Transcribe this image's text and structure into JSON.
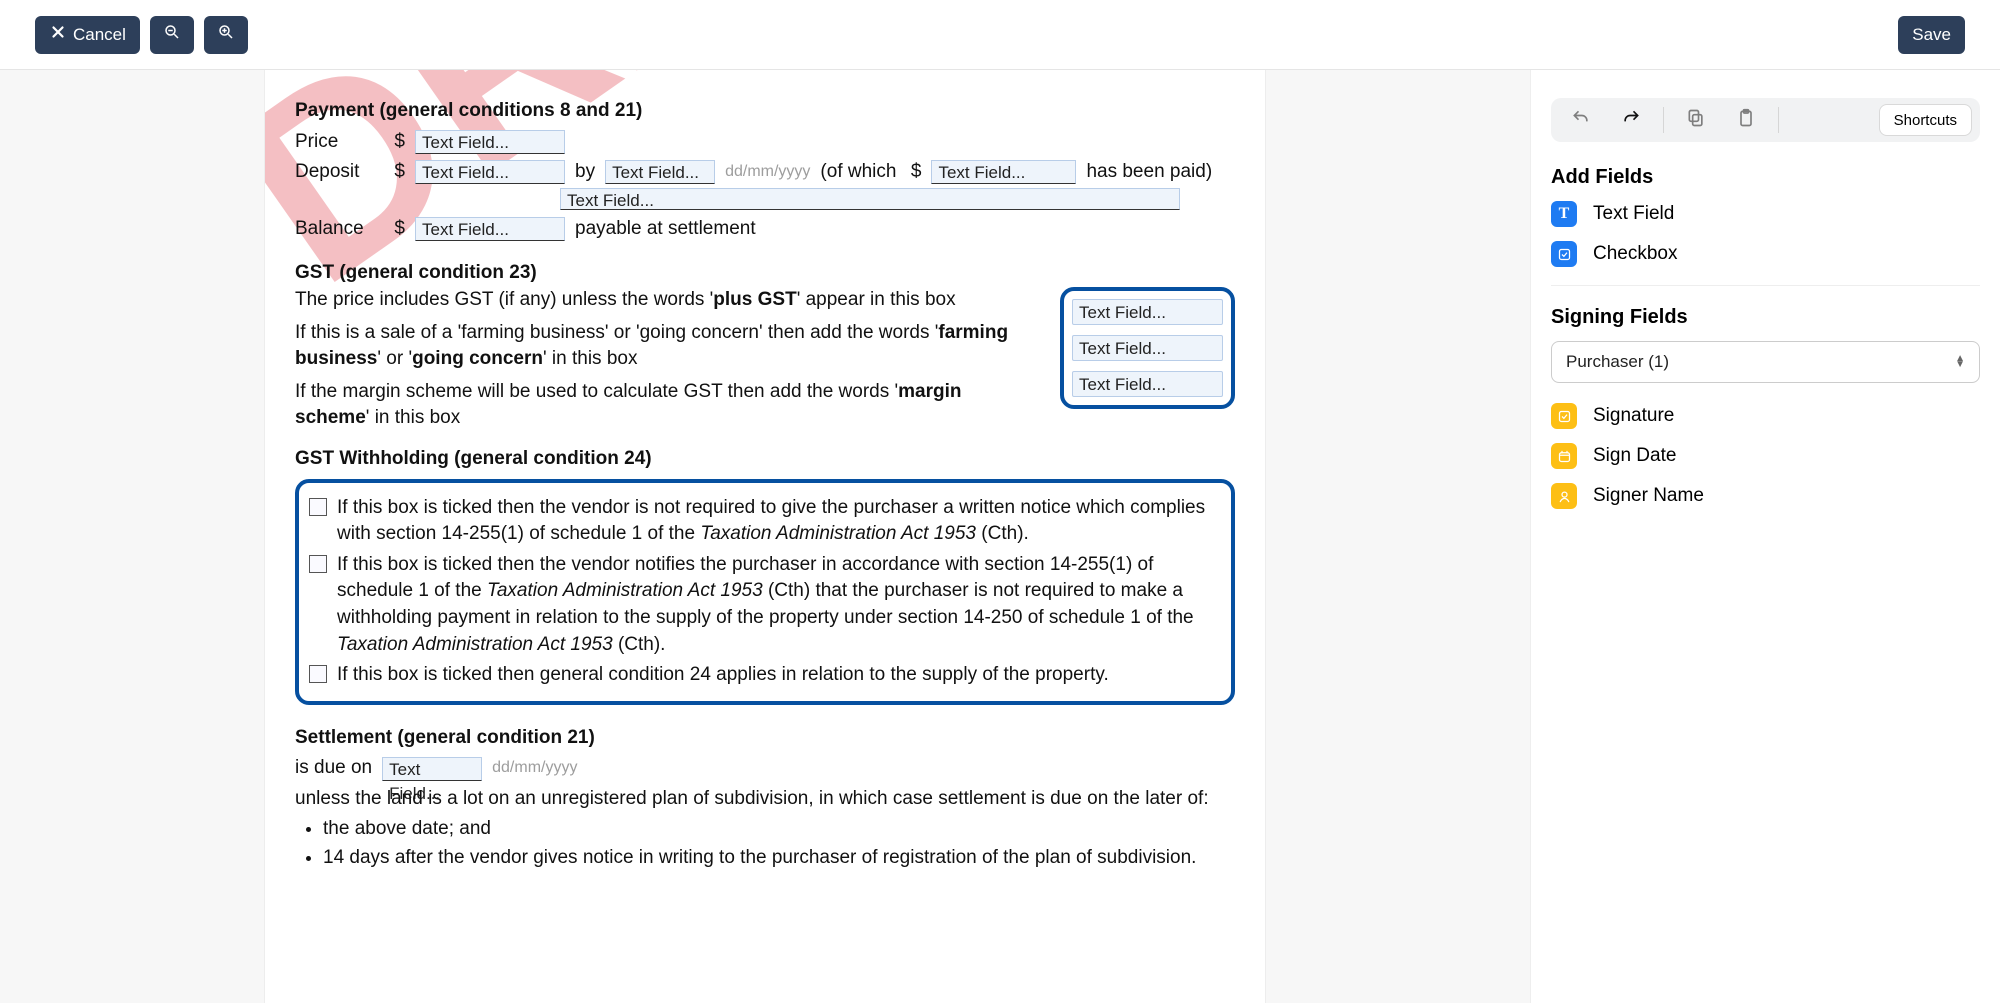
{
  "toolbar": {
    "cancel": "Cancel",
    "save": "Save"
  },
  "watermark": "DRAFT",
  "payment": {
    "heading": "Payment (general conditions 8 and 21)",
    "price_label": "Price",
    "price_ph": "Text Field...",
    "deposit_label": "Deposit",
    "deposit_ph": "Text Field...",
    "by_label": "by",
    "by_ph": "Text Field...",
    "by_hint": "dd/mm/yyyy",
    "of_which": "(of which",
    "paid_ph": "Text Field...",
    "paid_tail": "has been paid)",
    "long_ph": "Text Field...",
    "balance_label": "Balance",
    "balance_ph": "Text Field...",
    "payable": "payable at settlement"
  },
  "gst": {
    "heading": "GST (general condition 23)",
    "line1a": "The price includes GST (if any) unless the words '",
    "line1b": "plus GST",
    "line1c": "' appear in this box",
    "line2a": "If this is a sale of a 'farming business' or 'going concern' then add the words '",
    "line2b": "farming business",
    "line2c": "' or '",
    "line2d": "going concern",
    "line2e": "' in this box",
    "line3a": "If the margin scheme will be used to calculate GST then add the words '",
    "line3b": "margin scheme",
    "line3c": "' in this box",
    "box_ph1": "Text Field...",
    "box_ph2": "Text Field...",
    "box_ph3": "Text Field..."
  },
  "withholding": {
    "heading": "GST Withholding (general condition 24)",
    "item1a": "If this box is ticked then the vendor is not required to give the purchaser a written notice which complies with section 14-255(1) of schedule 1 of the ",
    "item1b": "Taxation Administration Act 1953",
    "item1c": " (Cth).",
    "item2a": "If this box is ticked then the vendor notifies the purchaser in accordance with section 14-255(1) of schedule 1 of the ",
    "item2b": "Taxation Administration Act 1953",
    "item2c": " (Cth) that the purchaser is not required to make a withholding payment in relation to the supply of the property under section 14-250 of schedule 1 of the ",
    "item2d": "Taxation Administration Act 1953",
    "item2e": " (Cth).",
    "item3": "If this box is ticked then general condition 24 applies in relation to the supply of the property."
  },
  "settlement": {
    "heading": "Settlement (general condition 21)",
    "due_on": "is due on",
    "due_ph": "Text Field...",
    "due_hint": "dd/mm/yyyy",
    "unless": "unless the land is a lot on an unregistered plan of subdivision, in which case settlement is due on the later of:",
    "b1": "the above date; and",
    "b2": "14 days after the vendor gives notice in writing to the purchaser of registration of the plan of subdivision."
  },
  "sidebar": {
    "shortcuts": "Shortcuts",
    "add_fields": "Add Fields",
    "text_field": "Text Field",
    "checkbox": "Checkbox",
    "signing_fields": "Signing Fields",
    "signer_select": "Purchaser (1)",
    "signature": "Signature",
    "sign_date": "Sign Date",
    "signer_name": "Signer Name"
  }
}
